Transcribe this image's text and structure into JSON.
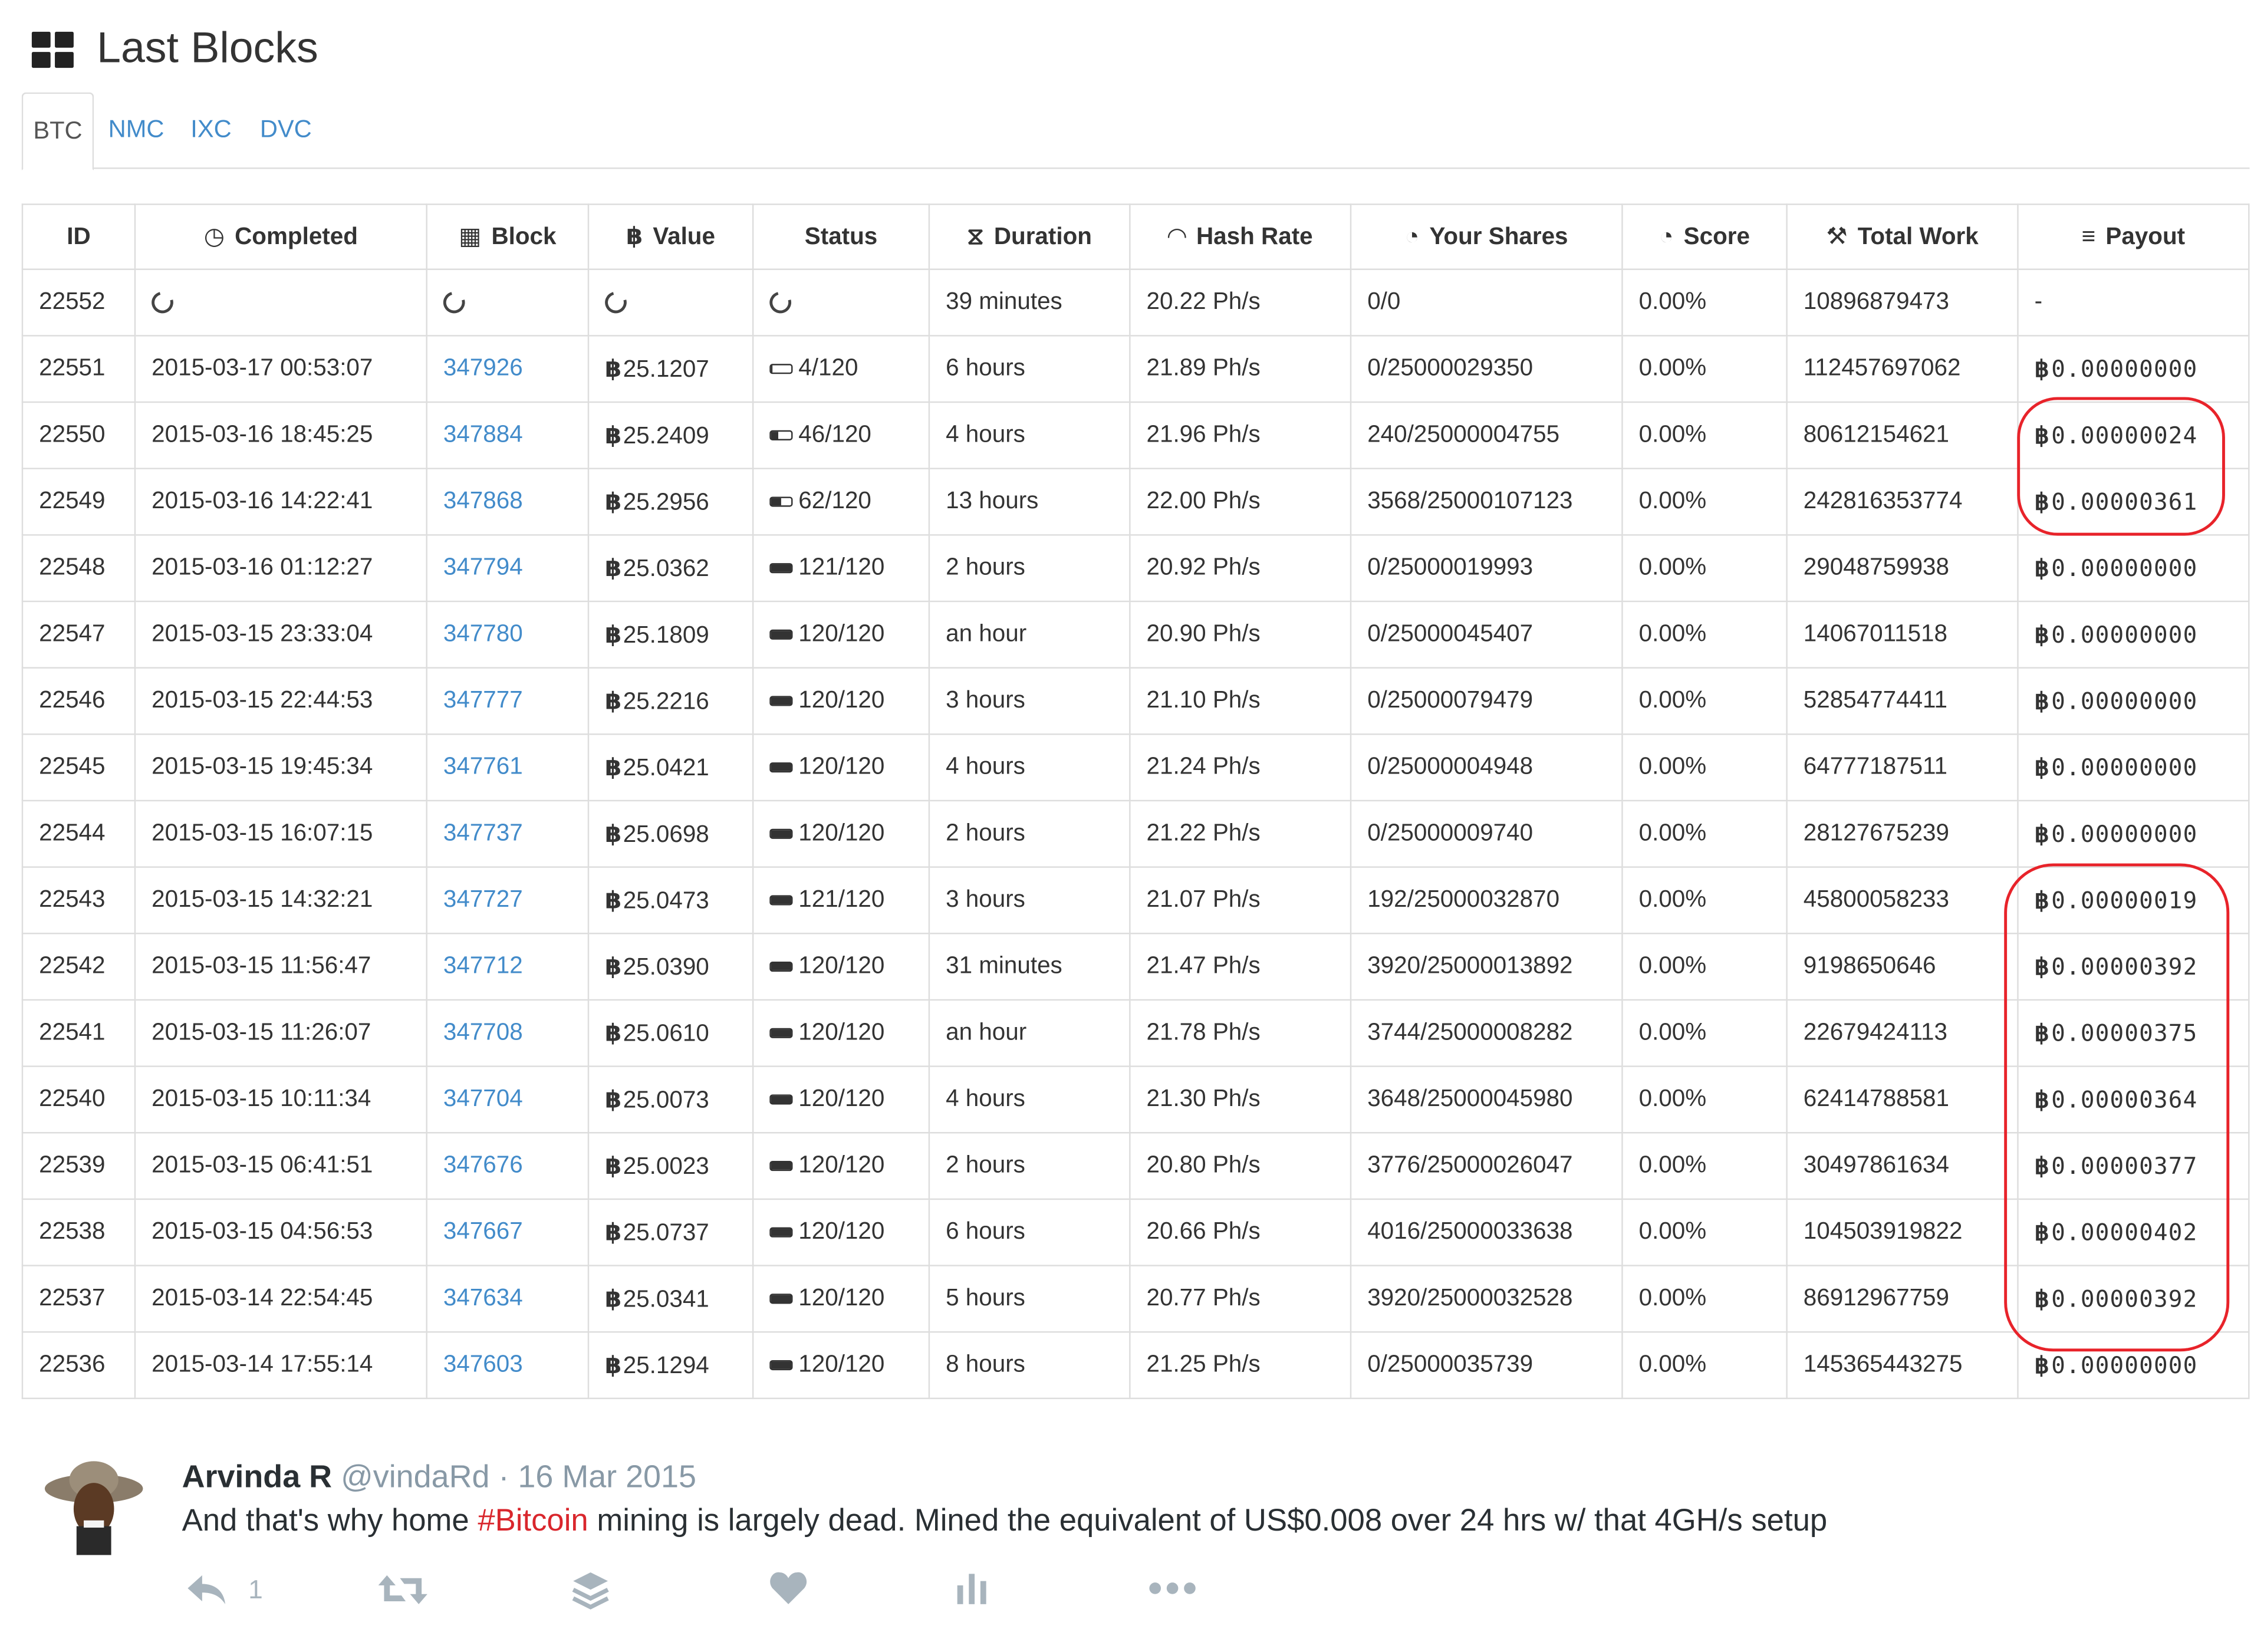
{
  "panel": {
    "title": "Last Blocks",
    "tabs": [
      {
        "label": "BTC",
        "active": true
      },
      {
        "label": "NMC",
        "active": false
      },
      {
        "label": "IXC",
        "active": false
      },
      {
        "label": "DVC",
        "active": false
      }
    ]
  },
  "table": {
    "headers": [
      {
        "label": "ID",
        "icon": ""
      },
      {
        "label": "Completed",
        "icon": "clock-icon"
      },
      {
        "label": "Block",
        "icon": "grid-icon"
      },
      {
        "label": "Value",
        "icon": "bitcoin-icon"
      },
      {
        "label": "Status",
        "icon": ""
      },
      {
        "label": "Duration",
        "icon": "hourglass-icon"
      },
      {
        "label": "Hash Rate",
        "icon": "dashboard-icon"
      },
      {
        "label": "Your Shares",
        "icon": "pie-icon"
      },
      {
        "label": "Score",
        "icon": "pie-icon"
      },
      {
        "label": "Total Work",
        "icon": "wrench-icon"
      },
      {
        "label": "Payout",
        "icon": "coins-icon"
      }
    ],
    "rows": [
      {
        "id": "22552",
        "completed": "",
        "block": "",
        "value": "",
        "status": "",
        "status_fill": 0,
        "duration": "39 minutes",
        "hashrate": "20.22 Ph/s",
        "shares": "0/0",
        "score": "0.00%",
        "work": "10896879473",
        "payout": "-",
        "pending": true
      },
      {
        "id": "22551",
        "completed": "2015-03-17 00:53:07",
        "block": "347926",
        "value": "25.1207",
        "status": "4/120",
        "status_fill": 0.03,
        "duration": "6 hours",
        "hashrate": "21.89 Ph/s",
        "shares": "0/25000029350",
        "score": "0.00%",
        "work": "112457697062",
        "payout": "0.00000000"
      },
      {
        "id": "22550",
        "completed": "2015-03-16 18:45:25",
        "block": "347884",
        "value": "25.2409",
        "status": "46/120",
        "status_fill": 0.38,
        "duration": "4 hours",
        "hashrate": "21.96 Ph/s",
        "shares": "240/25000004755",
        "score": "0.00%",
        "work": "80612154621",
        "payout": "0.00000024"
      },
      {
        "id": "22549",
        "completed": "2015-03-16 14:22:41",
        "block": "347868",
        "value": "25.2956",
        "status": "62/120",
        "status_fill": 0.52,
        "duration": "13 hours",
        "hashrate": "22.00 Ph/s",
        "shares": "3568/25000107123",
        "score": "0.00%",
        "work": "242816353774",
        "payout": "0.00000361"
      },
      {
        "id": "22548",
        "completed": "2015-03-16 01:12:27",
        "block": "347794",
        "value": "25.0362",
        "status": "121/120",
        "status_fill": 1,
        "duration": "2 hours",
        "hashrate": "20.92 Ph/s",
        "shares": "0/25000019993",
        "score": "0.00%",
        "work": "29048759938",
        "payout": "0.00000000"
      },
      {
        "id": "22547",
        "completed": "2015-03-15 23:33:04",
        "block": "347780",
        "value": "25.1809",
        "status": "120/120",
        "status_fill": 1,
        "duration": "an hour",
        "hashrate": "20.90 Ph/s",
        "shares": "0/25000045407",
        "score": "0.00%",
        "work": "14067011518",
        "payout": "0.00000000"
      },
      {
        "id": "22546",
        "completed": "2015-03-15 22:44:53",
        "block": "347777",
        "value": "25.2216",
        "status": "120/120",
        "status_fill": 1,
        "duration": "3 hours",
        "hashrate": "21.10 Ph/s",
        "shares": "0/25000079479",
        "score": "0.00%",
        "work": "52854774411",
        "payout": "0.00000000"
      },
      {
        "id": "22545",
        "completed": "2015-03-15 19:45:34",
        "block": "347761",
        "value": "25.0421",
        "status": "120/120",
        "status_fill": 1,
        "duration": "4 hours",
        "hashrate": "21.24 Ph/s",
        "shares": "0/25000004948",
        "score": "0.00%",
        "work": "64777187511",
        "payout": "0.00000000"
      },
      {
        "id": "22544",
        "completed": "2015-03-15 16:07:15",
        "block": "347737",
        "value": "25.0698",
        "status": "120/120",
        "status_fill": 1,
        "duration": "2 hours",
        "hashrate": "21.22 Ph/s",
        "shares": "0/25000009740",
        "score": "0.00%",
        "work": "28127675239",
        "payout": "0.00000000"
      },
      {
        "id": "22543",
        "completed": "2015-03-15 14:32:21",
        "block": "347727",
        "value": "25.0473",
        "status": "121/120",
        "status_fill": 1,
        "duration": "3 hours",
        "hashrate": "21.07 Ph/s",
        "shares": "192/25000032870",
        "score": "0.00%",
        "work": "45800058233",
        "payout": "0.00000019"
      },
      {
        "id": "22542",
        "completed": "2015-03-15 11:56:47",
        "block": "347712",
        "value": "25.0390",
        "status": "120/120",
        "status_fill": 1,
        "duration": "31 minutes",
        "hashrate": "21.47 Ph/s",
        "shares": "3920/25000013892",
        "score": "0.00%",
        "work": "9198650646",
        "payout": "0.00000392"
      },
      {
        "id": "22541",
        "completed": "2015-03-15 11:26:07",
        "block": "347708",
        "value": "25.0610",
        "status": "120/120",
        "status_fill": 1,
        "duration": "an hour",
        "hashrate": "21.78 Ph/s",
        "shares": "3744/25000008282",
        "score": "0.00%",
        "work": "22679424113",
        "payout": "0.00000375"
      },
      {
        "id": "22540",
        "completed": "2015-03-15 10:11:34",
        "block": "347704",
        "value": "25.0073",
        "status": "120/120",
        "status_fill": 1,
        "duration": "4 hours",
        "hashrate": "21.30 Ph/s",
        "shares": "3648/25000045980",
        "score": "0.00%",
        "work": "62414788581",
        "payout": "0.00000364"
      },
      {
        "id": "22539",
        "completed": "2015-03-15 06:41:51",
        "block": "347676",
        "value": "25.0023",
        "status": "120/120",
        "status_fill": 1,
        "duration": "2 hours",
        "hashrate": "20.80 Ph/s",
        "shares": "3776/25000026047",
        "score": "0.00%",
        "work": "30497861634",
        "payout": "0.00000377"
      },
      {
        "id": "22538",
        "completed": "2015-03-15 04:56:53",
        "block": "347667",
        "value": "25.0737",
        "status": "120/120",
        "status_fill": 1,
        "duration": "6 hours",
        "hashrate": "20.66 Ph/s",
        "shares": "4016/25000033638",
        "score": "0.00%",
        "work": "104503919822",
        "payout": "0.00000402"
      },
      {
        "id": "22537",
        "completed": "2015-03-14 22:54:45",
        "block": "347634",
        "value": "25.0341",
        "status": "120/120",
        "status_fill": 1,
        "duration": "5 hours",
        "hashrate": "20.77 Ph/s",
        "shares": "3920/25000032528",
        "score": "0.00%",
        "work": "86912967759",
        "payout": "0.00000392"
      },
      {
        "id": "22536",
        "completed": "2015-03-14 17:55:14",
        "block": "347603",
        "value": "25.1294",
        "status": "120/120",
        "status_fill": 1,
        "duration": "8 hours",
        "hashrate": "21.25 Ph/s",
        "shares": "0/25000035739",
        "score": "0.00%",
        "work": "145365443275",
        "payout": "0.00000000"
      }
    ]
  },
  "currency_symbol": "฿",
  "tweet": {
    "name": "Arvinda R",
    "handle": "@vindaRd",
    "separator": "·",
    "date": "16 Mar 2015",
    "text_before": "And that's why home ",
    "hashtag": "#Bitcoin",
    "text_after": " mining is largely dead. Mined the equivalent of US$0.008 over 24 hrs w/ that 4GH/s setup",
    "reply_count": "1",
    "actions": [
      "reply-icon",
      "retweet-icon",
      "buffer-icon",
      "heart-icon",
      "analytics-icon",
      "more-icon"
    ]
  },
  "colors": {
    "link": "#428bca",
    "highlight": "#e8232a",
    "hashtag": "#d9262c",
    "tweet_icon": "#a8b4bd"
  }
}
